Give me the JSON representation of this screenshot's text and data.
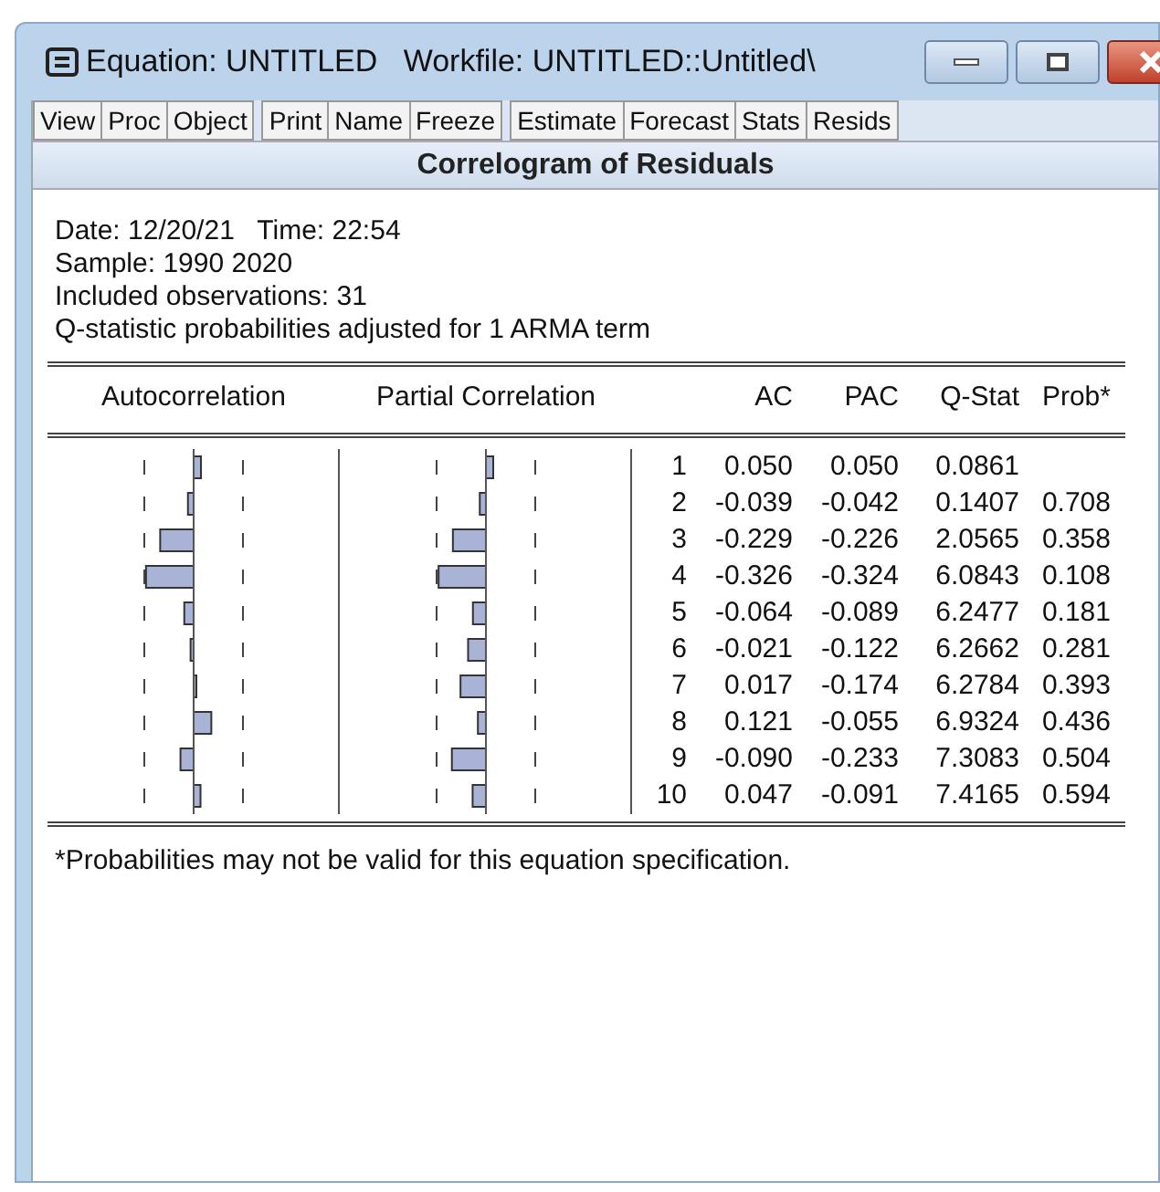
{
  "window": {
    "title": "Equation: UNTITLED   Workfile: UNTITLED::Untitled\\"
  },
  "toolbar": [
    [
      "View",
      "Proc",
      "Object"
    ],
    [
      "Print",
      "Name",
      "Freeze"
    ],
    [
      "Estimate",
      "Forecast",
      "Stats",
      "Resids"
    ]
  ],
  "view_title": "Correlogram of Residuals",
  "info": [
    "Date: 12/20/21   Time: 22:54",
    "Sample: 1990 2020",
    "Included observations: 31",
    "Q-statistic probabilities adjusted for 1 ARMA term"
  ],
  "table": {
    "columns": [
      "Autocorrelation",
      "Partial Correlation",
      "AC",
      "PAC",
      "Q-Stat",
      "Prob*"
    ],
    "rows": [
      {
        "lag": "1",
        "ac": "0.050",
        "pac": "0.050",
        "qstat": "0.0861"
      },
      {
        "lag": "2",
        "ac": "-0.039",
        "pac": "-0.042",
        "qstat": "0.1407",
        "prob": "0.708"
      },
      {
        "lag": "3",
        "ac": "-0.229",
        "pac": "-0.226",
        "qstat": "2.0565",
        "prob": "0.358"
      },
      {
        "lag": "4",
        "ac": "-0.326",
        "pac": "-0.324",
        "qstat": "6.0843",
        "prob": "0.108"
      },
      {
        "lag": "5",
        "ac": "-0.064",
        "pac": "-0.089",
        "qstat": "6.2477",
        "prob": "0.181"
      },
      {
        "lag": "6",
        "ac": "-0.021",
        "pac": "-0.122",
        "qstat": "6.2662",
        "prob": "0.281"
      },
      {
        "lag": "7",
        "ac": "0.017",
        "pac": "-0.174",
        "qstat": "6.2784",
        "prob": "0.393"
      },
      {
        "lag": "8",
        "ac": "0.121",
        "pac": "-0.055",
        "qstat": "6.9324",
        "prob": "0.436"
      },
      {
        "lag": "9",
        "ac": "-0.090",
        "pac": "-0.233",
        "qstat": "7.3083",
        "prob": "0.504"
      },
      {
        "lag": "10",
        "ac": "0.047",
        "pac": "-0.091",
        "qstat": "7.4165",
        "prob": "0.594"
      }
    ]
  },
  "footnote": "*Probabilities may not be valid for this equation specification."
}
